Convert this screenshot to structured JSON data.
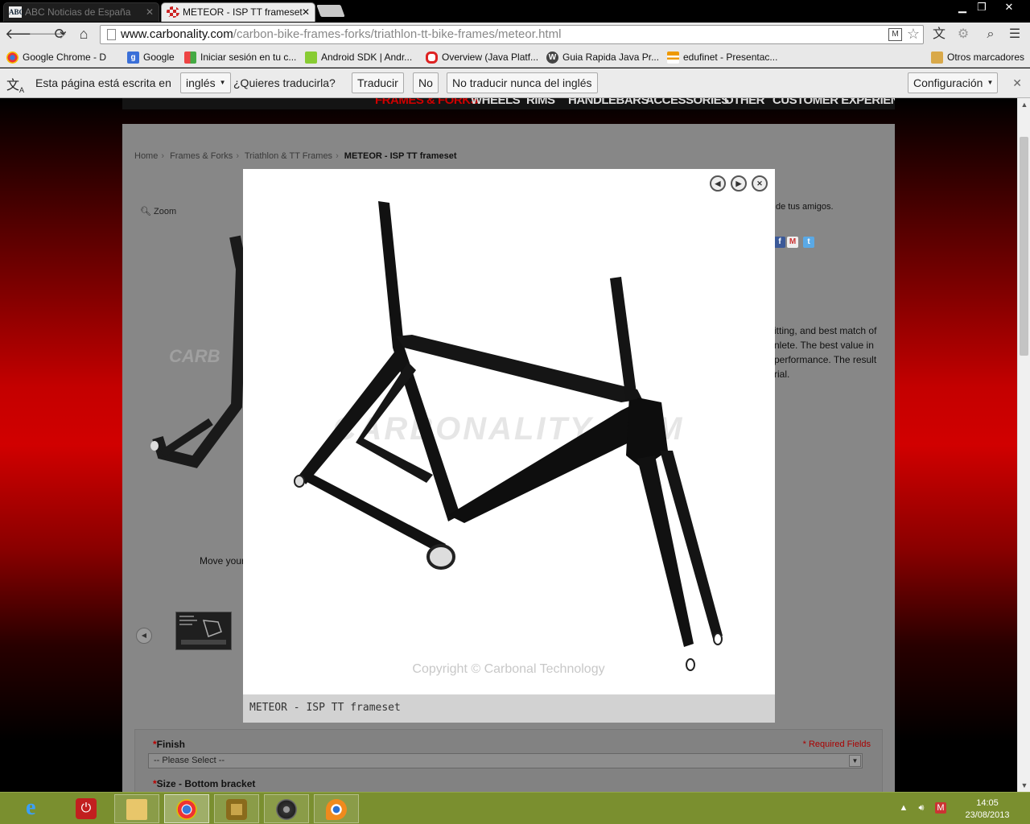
{
  "browser": {
    "tabs": [
      {
        "title": "ABC Noticias de España",
        "favicon": "ABC"
      },
      {
        "title": "METEOR - ISP TT frameset",
        "favicon": "carbonality-icon"
      }
    ],
    "url": {
      "host": "www.carbonality.com",
      "path": "/carbon-bike-frames-forks/triathlon-tt-bike-frames/meteor.html"
    },
    "bookmarks": [
      {
        "label": "Google Chrome - D",
        "icon": "chrome-icon"
      },
      {
        "label": "Google",
        "icon": "google-icon"
      },
      {
        "label": "Iniciar sesión en tu c...",
        "icon": "microsoft-icon"
      },
      {
        "label": "Android SDK | Andr...",
        "icon": "android-icon"
      },
      {
        "label": "Overview (Java Platf...",
        "icon": "oracle-icon"
      },
      {
        "label": "Guia Rapida Java Pr...",
        "icon": "wordpress-icon"
      },
      {
        "label": "edufinet - Presentac...",
        "icon": "edufinet-icon"
      },
      {
        "label": "Otros marcadores",
        "icon": "folder-icon"
      }
    ],
    "translate_bar": {
      "prefix": "Esta página está escrita en",
      "language": "inglés",
      "question": "¿Quieres traducirla?",
      "translate_button": "Traducir",
      "no_button": "No",
      "never_button": "No traducir nunca del inglés",
      "settings_button": "Configuración"
    }
  },
  "site": {
    "nav": [
      "FRAMES & FORKS",
      "WHEELS",
      "RIMS",
      "HANDLEBARS",
      "ACCESSORIES",
      "OTHER",
      "CUSTOMER EXPERIENCE"
    ],
    "active_nav": "FRAMES & FORKS",
    "breadcrumb": [
      "Home",
      "Frames & Forks",
      "Triathlon & TT Frames",
      "METEOR - ISP TT frameset"
    ],
    "zoom_label": "Zoom",
    "move_text": "Move your",
    "friends_text": "de tus amigos.",
    "description_lines": [
      "itting, and best match of",
      "nlete. The best value in",
      "performance. The result",
      "rial."
    ],
    "options": {
      "finish_label": "Finish",
      "required_text": "* Required Fields",
      "finish_placeholder": "-- Please Select --",
      "size_label": "Size - Bottom bracket"
    }
  },
  "lightbox": {
    "caption": "METEOR - ISP TT frameset",
    "watermark": "CARBONALITY.COM",
    "copyright": "Copyright © Carbonal Technology"
  },
  "taskbar": {
    "time": "14:05",
    "date": "23/08/2013"
  }
}
